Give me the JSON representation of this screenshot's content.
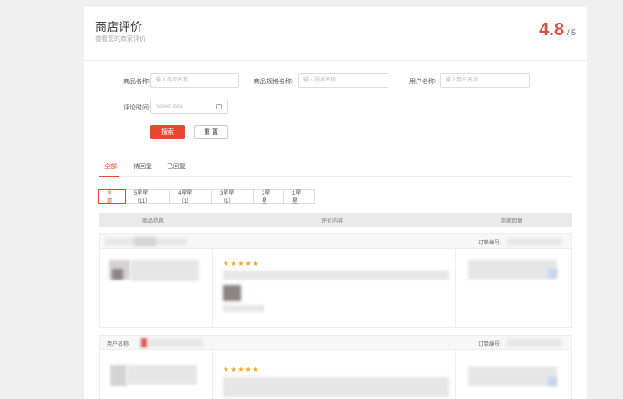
{
  "header": {
    "title": "商店评价",
    "subtitle": "查看您的商家评价",
    "score": "4.8",
    "score_total": "/ 5"
  },
  "filters_form": {
    "product_name_label": "商品名称:",
    "product_name_placeholder": "输入商品名称",
    "spec_name_label": "商品规格名称:",
    "spec_name_placeholder": "输入规格名称",
    "user_name_label": "用户名称:",
    "user_name_placeholder": "输入用户名称",
    "review_time_label": "评论时间:",
    "review_time_placeholder": "Select date",
    "search_label": "搜索",
    "reset_label": "重 置"
  },
  "tabs": [
    {
      "label": "全部",
      "active": true
    },
    {
      "label": "待回复",
      "active": false
    },
    {
      "label": "已回复",
      "active": false
    }
  ],
  "rating_filters": [
    {
      "label": "全部",
      "active": true
    },
    {
      "label": "5星星（11）",
      "active": false
    },
    {
      "label": "4星星（1）",
      "active": false
    },
    {
      "label": "3星星（1）",
      "active": false
    },
    {
      "label": "2星星",
      "active": false
    },
    {
      "label": "1星星",
      "active": false
    }
  ],
  "table_headers": {
    "product": "商品信息",
    "content": "评价内容",
    "reply": "商家回复"
  },
  "reviews": [
    {
      "user_label": "",
      "order_label": "订单编号:",
      "stars": "★★★★★",
      "rating": 5
    },
    {
      "user_label": "用户名称:",
      "order_label": "订单编号:",
      "stars": "★★★★★",
      "rating": 5
    }
  ],
  "colors": {
    "accent": "#e8462f",
    "star": "#f5a623"
  }
}
